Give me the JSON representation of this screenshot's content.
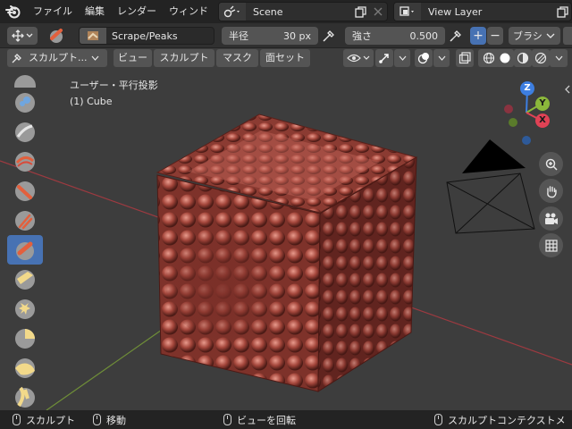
{
  "menu": {
    "items": [
      "ファイル",
      "編集",
      "レンダー",
      "ウィンド"
    ],
    "scene": "Scene",
    "view_layer": "View Layer"
  },
  "tool_header": {
    "brush_name": "Scrape/Peaks",
    "radius_label": "半径",
    "radius_value": "30 px",
    "strength_label": "強さ",
    "strength_value": "0.500",
    "plus": "+",
    "minus": "−",
    "brush_menu": "ブラシ"
  },
  "mode_header": {
    "mode": "スカルプト...",
    "menus": [
      "ビュー",
      "スカルプト",
      "マスク",
      "面セット"
    ]
  },
  "viewport": {
    "view_name": "ユーザー・平行投影",
    "object_name": "(1) Cube",
    "axes": {
      "z": "Z",
      "y": "Y",
      "x": "X"
    }
  },
  "status": {
    "left_action": "スカルプト",
    "middle_action": "移動",
    "rotate_action": "ビューを回転",
    "right_action": "スカルプトコンテクストメ"
  },
  "colors": {
    "accent": "#4772b3",
    "axis_x": "#e04255",
    "axis_y": "#8bb83b",
    "axis_z": "#3d7ee0",
    "surface": "#b5554a"
  }
}
